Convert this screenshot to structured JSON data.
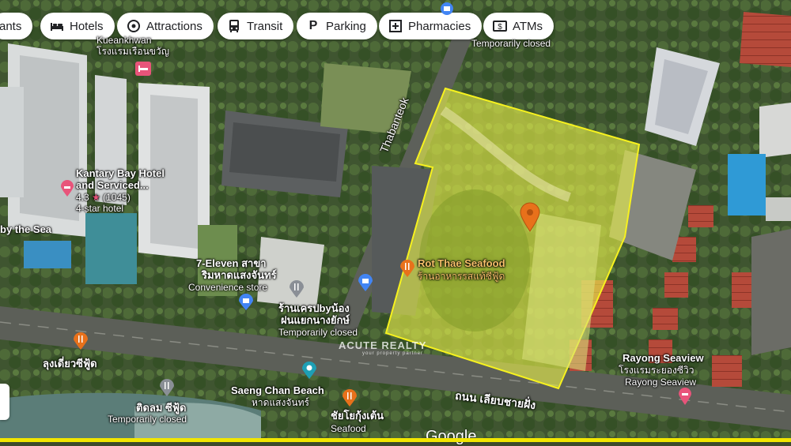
{
  "chips": [
    {
      "label": "rants",
      "icon": "restaurant-icon"
    },
    {
      "label": "Hotels",
      "icon": "bed-icon"
    },
    {
      "label": "Attractions",
      "icon": "camera-icon"
    },
    {
      "label": "Transit",
      "icon": "bus-icon"
    },
    {
      "label": "Parking",
      "icon": "parking-icon"
    },
    {
      "label": "Pharmacies",
      "icon": "pharmacy-icon"
    },
    {
      "label": "ATMs",
      "icon": "atm-icon"
    }
  ],
  "places": {
    "kueankhwan": {
      "name_en": "Kueankhwan",
      "name_th": "โรงแรมเรือนขวัญ"
    },
    "kantary": {
      "line1": "Kantary Bay Hotel",
      "line2": "and Serviced...",
      "rating": "4.3",
      "star": "★",
      "reviews": "(1045)",
      "type": "4-star hotel"
    },
    "by_the_sea": "by the Sea",
    "seven_eleven": {
      "line1": "7-Eleven สาขา",
      "line2": "ริมหาดแสงจันทร์",
      "type": "Convenience store"
    },
    "crepe": {
      "line1": "ร้านเครปbyน้อง",
      "line2": "ฝนแยกนางยักษ์",
      "status": "Temporarily closed"
    },
    "top_closed": "Temporarily closed",
    "rot_thae": {
      "name_en": "Rot Thae Seafood",
      "name_th": "ร้านอาหารรสแท้ซีฟู้ด"
    },
    "lung_diao": "ลุงเดี่ยวซีฟู้ด",
    "tidlom": {
      "name": "ติดลม ซีฟู้ด",
      "status": "Temporarily closed"
    },
    "saeng_chan": {
      "name_en": "Saeng Chan Beach",
      "name_th": "หาดแสงจันทร์"
    },
    "chaiyo": {
      "name_th": "ชัยโยกุ้งเต้น",
      "type": "Seafood"
    },
    "rayong_seaview": {
      "name_en": "Rayong Seaview",
      "name_th": "โรงแรมระยองซีวิว",
      "sub": "Rayong Seaview"
    }
  },
  "roads": {
    "thabanteok": "Thabanteok",
    "coastal": "ถนน เลียบชายฝั่ง"
  },
  "watermark": {
    "text": "ACUTE REALTY",
    "tagline": "your property partner"
  },
  "google": "Google",
  "colors": {
    "parcel_fill": "#e8f04a",
    "parcel_stroke": "#f7f21e",
    "pin_orange": "#e8711b",
    "pin_red": "#e8547a"
  }
}
